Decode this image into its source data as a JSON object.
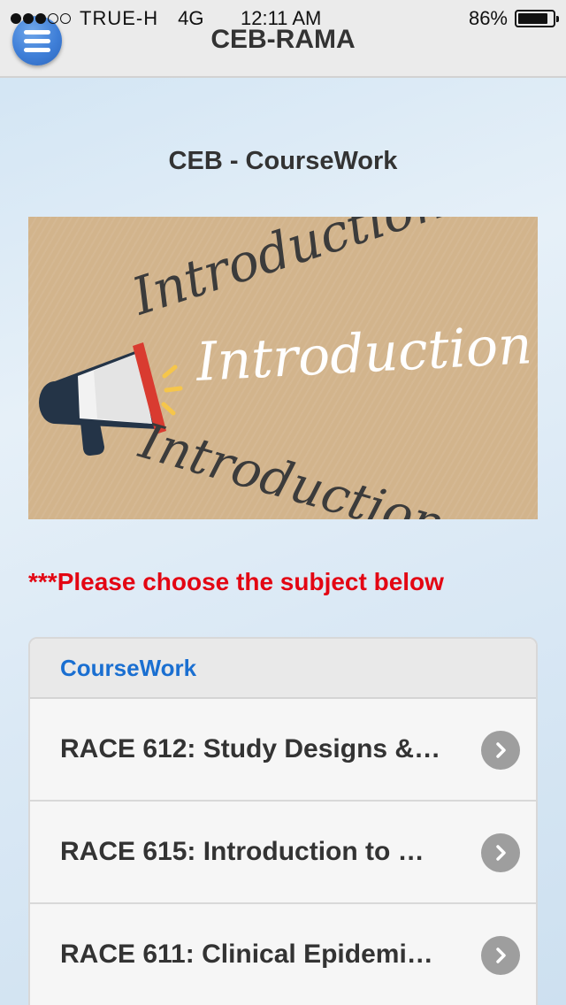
{
  "status_bar": {
    "carrier": "TRUE-H",
    "network": "4G",
    "time": "12:11 AM",
    "battery": "86%",
    "battery_level": 0.86
  },
  "header": {
    "title": "CEB-RAMA"
  },
  "page": {
    "section_title": "CEB - CourseWork",
    "banner_words": [
      "Introduction",
      "Introduction",
      "Introduction"
    ],
    "notice": "***Please choose the subject below"
  },
  "list": {
    "header": "CourseWork",
    "items": [
      {
        "label": "RACE 612: Study Designs &…"
      },
      {
        "label": "RACE 615: Introduction to …"
      },
      {
        "label": "RACE 611: Clinical Epidemi…"
      }
    ]
  },
  "colors": {
    "accent_blue": "#1a6fd1",
    "notice_red": "#e30613",
    "banner_tan": "#d2b48c"
  }
}
